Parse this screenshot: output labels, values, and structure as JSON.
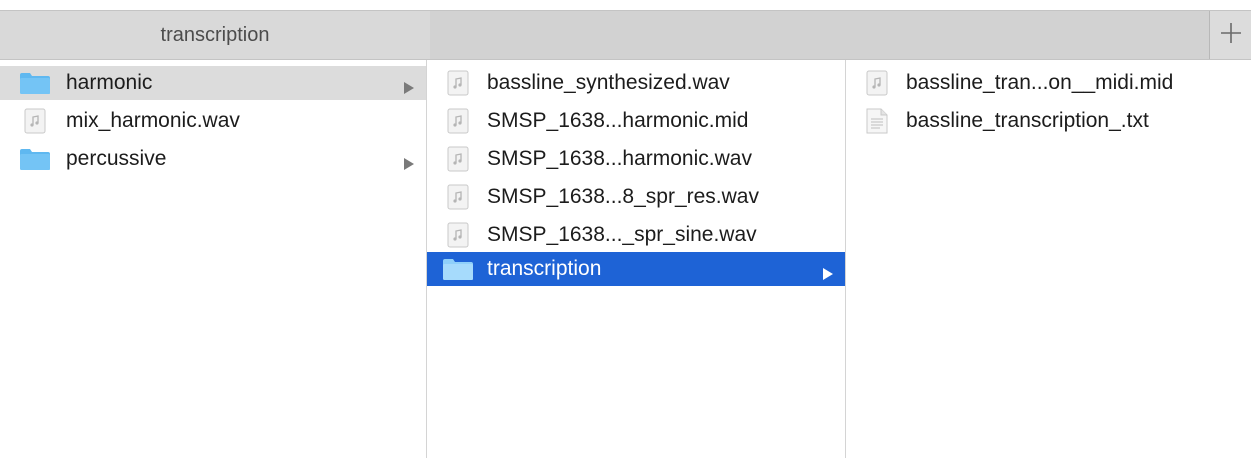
{
  "tab": {
    "title": "transcription"
  },
  "columns": [
    {
      "items": [
        {
          "name": "harmonic",
          "type": "folder",
          "selected": "inactive",
          "arrow": true
        },
        {
          "name": "mix_harmonic.wav",
          "type": "audio"
        },
        {
          "name": "percussive",
          "type": "folder",
          "arrow": true
        }
      ]
    },
    {
      "items": [
        {
          "name": "bassline_synthesized.wav",
          "type": "audio"
        },
        {
          "name": "SMSP_1638...harmonic.mid",
          "type": "audio"
        },
        {
          "name": "SMSP_1638...harmonic.wav",
          "type": "audio"
        },
        {
          "name": "SMSP_1638...8_spr_res.wav",
          "type": "audio"
        },
        {
          "name": "SMSP_1638..._spr_sine.wav",
          "type": "audio"
        },
        {
          "name": "transcription",
          "type": "folder",
          "selected": "active",
          "arrow": true
        }
      ]
    },
    {
      "items": [
        {
          "name": "bassline_tran...on__midi.mid",
          "type": "audio"
        },
        {
          "name": "bassline_transcription_.txt",
          "type": "text"
        }
      ]
    }
  ],
  "colors": {
    "selection_active": "#1e63d6",
    "selection_inactive": "#dcdcdc",
    "folder": "#5fb8f0"
  },
  "icons": {
    "folder": "folder-icon",
    "audio": "audio-file-icon",
    "text": "text-file-icon",
    "arrow": "disclosure-arrow-icon",
    "add": "plus-icon"
  }
}
